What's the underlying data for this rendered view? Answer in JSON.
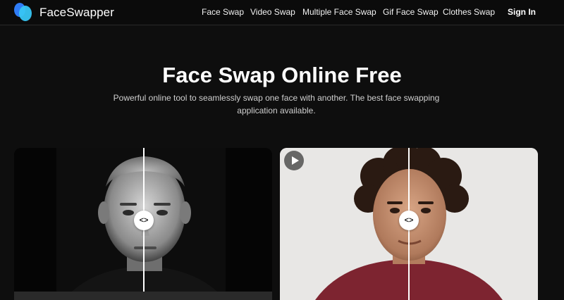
{
  "brand": {
    "name": "FaceSwapper",
    "logo_icon": "blue-overlapping-circles-logo",
    "colors": {
      "primary": "#2f7cf6",
      "secondary": "#38c6f4"
    }
  },
  "nav": {
    "items": [
      {
        "label": "Face Swap"
      },
      {
        "label": "Video Swap"
      },
      {
        "label": "Multiple Face Swap"
      },
      {
        "label": "Gif Face Swap"
      },
      {
        "label": "Clothes Swap"
      }
    ],
    "signin": "Sign In"
  },
  "hero": {
    "title": "Face Swap Online Free",
    "subtitle": "Powerful online tool to seamlessly swap one face with another. The best face swapping application available."
  },
  "compare": {
    "handle_glyph": "<>",
    "left_card": {
      "style": "black-and-white portrait"
    },
    "right_card": {
      "style": "color portrait",
      "play_icon": "play-icon"
    }
  }
}
